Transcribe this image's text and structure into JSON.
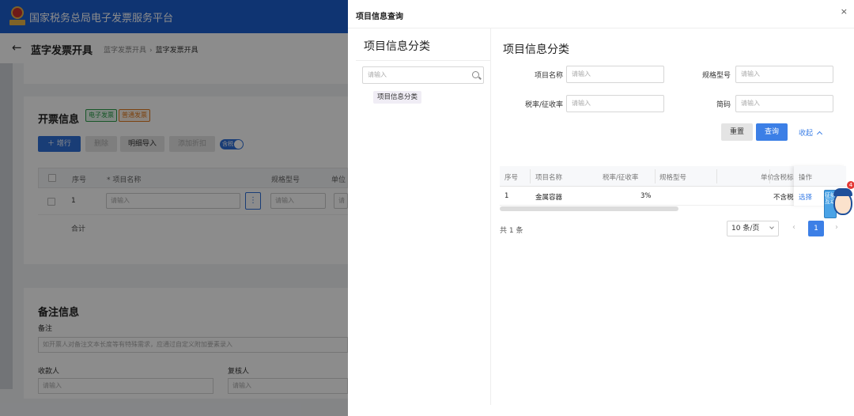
{
  "app": {
    "title": "国家税务总局电子发票服务平台",
    "page_title": "蓝字发票开具",
    "breadcrumb": [
      "蓝字发票开具",
      "蓝字发票开具"
    ]
  },
  "invoice_section": {
    "title": "开票信息",
    "tags": [
      "电子发票",
      "普通发票"
    ],
    "toolbar": {
      "add": "增行",
      "delete": "删除",
      "import": "明细导入",
      "discount": "添加折扣",
      "tax_switch": "含税"
    },
    "columns": [
      "序号",
      "* 项目名称",
      "规格型号",
      "单位"
    ],
    "row": {
      "index": "1",
      "name_placeholder": "请输入",
      "spec_placeholder": "请输入",
      "unit_placeholder": "请"
    },
    "total_label": "合计"
  },
  "remarks_section": {
    "title": "备注信息",
    "remark_label": "备注",
    "remark_placeholder": "如开票人对备注文本长度等有特殊需求，应通过自定义附加要素录入",
    "payee_label": "收款人",
    "payee_placeholder": "请输入",
    "reviewer_label": "复核人",
    "reviewer_placeholder": "请输入"
  },
  "drawer": {
    "title": "项目信息查询",
    "close_glyph": "×",
    "category": {
      "title": "项目信息分类",
      "search_placeholder": "请输入",
      "node": "项目信息分类"
    },
    "query": {
      "title": "项目信息分类",
      "fields": {
        "name": {
          "label": "项目名称",
          "placeholder": "请输入"
        },
        "spec": {
          "label": "规格型号",
          "placeholder": "请输入"
        },
        "rate": {
          "label": "税率/征收率",
          "placeholder": "请输入"
        },
        "abbr": {
          "label": "简码",
          "placeholder": "请输入"
        }
      },
      "reset": "重置",
      "search": "查询",
      "collapse": "收起"
    },
    "table": {
      "headers": {
        "index": "序号",
        "name": "项目名称",
        "rate": "税率/征收率",
        "spec": "规格型号",
        "unit_price": "单价",
        "tax_incl": "含税标",
        "action": "操作"
      },
      "rows": [
        {
          "index": "1",
          "name": "金属容器",
          "rate": "3%",
          "spec": "",
          "unit_price": "",
          "tax_incl": "不含税",
          "action": "选择"
        }
      ]
    },
    "pagination": {
      "total": "共 1 条",
      "page_size": "10 条/页",
      "prev": "‹",
      "current": "1",
      "next": "›"
    }
  },
  "assistant": {
    "sign": "征纳互动",
    "badge": "4"
  }
}
